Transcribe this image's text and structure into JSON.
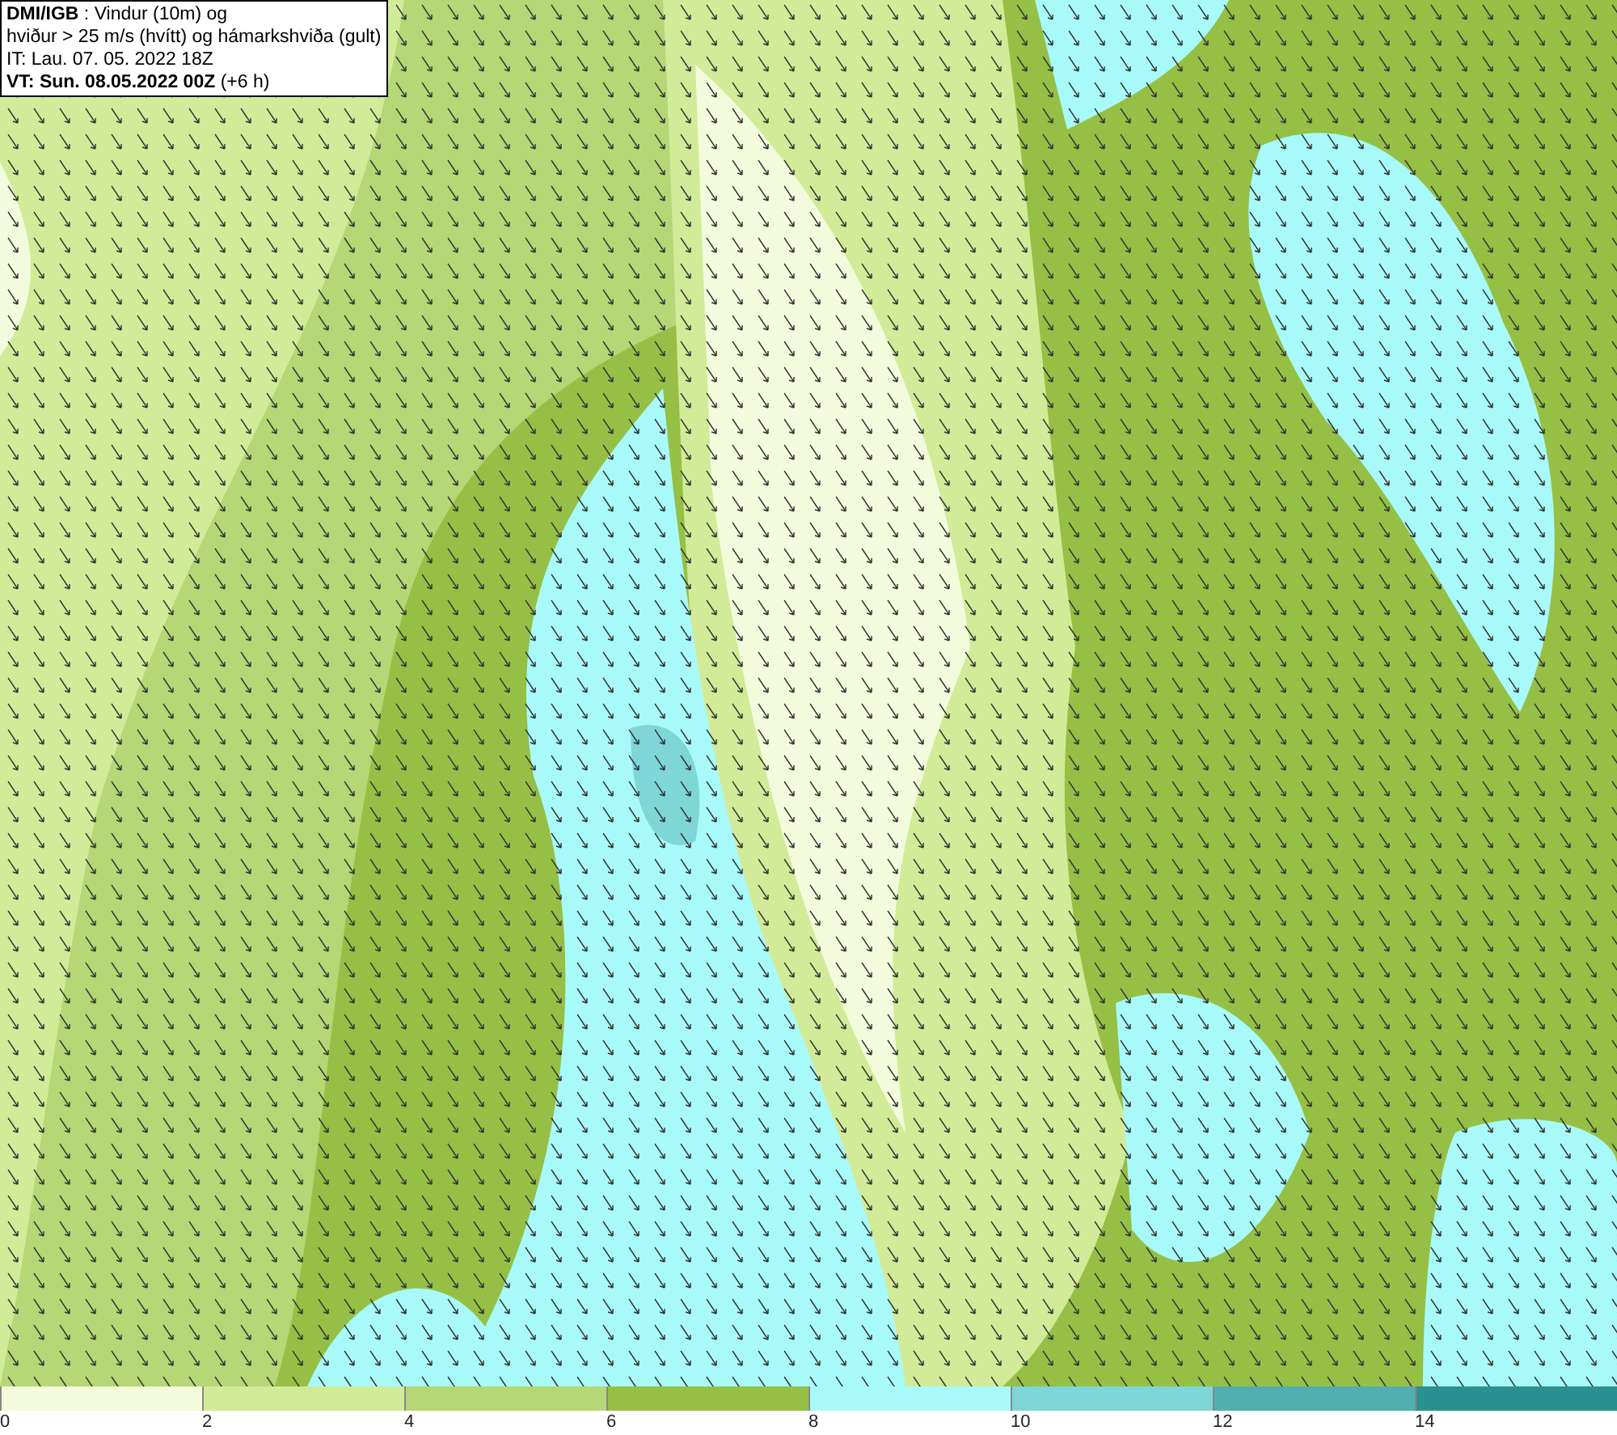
{
  "header": {
    "lines": [
      "**DMI/IGB** : Vindur (10m) og",
      "hviður > 25 m/s (hvítt) og hámarkshviða (gult)",
      "IT: Lau. 07. 05. 2022 18Z",
      "**VT: Sun. 08.05.2022 00Z** (+6 h)"
    ]
  },
  "legend": {
    "bands": [
      {
        "label": "0",
        "color": "#f4fbdc"
      },
      {
        "label": "2",
        "color": "#d2eb98"
      },
      {
        "label": "4",
        "color": "#b5d775"
      },
      {
        "label": "6",
        "color": "#96c045"
      },
      {
        "label": "8",
        "color": "#a8fafa"
      },
      {
        "label": "10",
        "color": "#7ed6d6"
      },
      {
        "label": "12",
        "color": "#50b0b0"
      },
      {
        "label": "14",
        "color": "#2a9090"
      }
    ]
  }
}
